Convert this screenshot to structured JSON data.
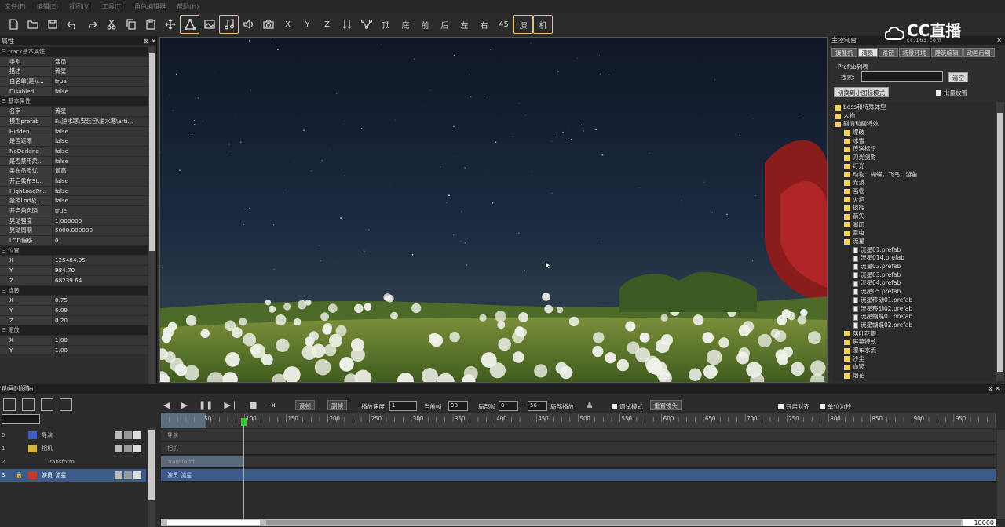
{
  "menubar": [
    "文件(F)",
    "编辑(E)",
    "视图(V)",
    "工具(T)",
    "角色编辑器",
    "帮助(H)"
  ],
  "toolbar": {
    "text_buttons": [
      "X",
      "Y",
      "Z",
      "顶",
      "底",
      "前",
      "后",
      "左",
      "右",
      "45"
    ],
    "highlight_buttons": [
      "演",
      "机"
    ]
  },
  "props_panel": {
    "title": "属性",
    "rows": [
      {
        "section": "track基本属性"
      },
      {
        "k": "类别",
        "v": "演员"
      },
      {
        "k": "描述",
        "v": "流星"
      },
      {
        "k": "白名单(是)/...",
        "v": "true"
      },
      {
        "k": "Disabled",
        "v": "false"
      },
      {
        "section": "基本属性"
      },
      {
        "k": "名字",
        "v": "流星"
      },
      {
        "k": "模型prefab",
        "v": "F:\\逆水寒\\安装包\\逆水寒\\arti..."
      },
      {
        "k": "Hidden",
        "v": "false"
      },
      {
        "k": "是否遮雨",
        "v": "false"
      },
      {
        "k": "NoDarking",
        "v": "false"
      },
      {
        "k": "是否禁用柔...",
        "v": "false"
      },
      {
        "k": "柔布品质优",
        "v": "最高"
      },
      {
        "k": "开启柔布St...",
        "v": "false"
      },
      {
        "k": "HighLoadPr...",
        "v": "false"
      },
      {
        "k": "禁掉Lod及...",
        "v": "false"
      },
      {
        "k": "开启角色阴",
        "v": "true"
      },
      {
        "k": "晃动强度",
        "v": "1.000000"
      },
      {
        "k": "晃动周期",
        "v": "5000.000000"
      },
      {
        "k": "LOD偏移",
        "v": "0"
      },
      {
        "section": "位置"
      },
      {
        "k": "X",
        "v": "125484.95"
      },
      {
        "k": "Y",
        "v": "984.70"
      },
      {
        "k": "Z",
        "v": "68239.64"
      },
      {
        "section": "旋转"
      },
      {
        "k": "X",
        "v": "0.75"
      },
      {
        "k": "Y",
        "v": "6.09"
      },
      {
        "k": "Z",
        "v": "0.20"
      },
      {
        "section": "缩放"
      },
      {
        "k": "X",
        "v": "1.00"
      },
      {
        "k": "Y",
        "v": "1.00"
      }
    ]
  },
  "control_panel": {
    "title": "主控制台",
    "logo": "CC直播",
    "logo_sub": "cc.163.com",
    "tabs": [
      "摄像机",
      "演员",
      "路径",
      "场景环境",
      "建筑编辑",
      "动画后期"
    ],
    "active_tab": "演员",
    "prefab_label": "Prefab列表",
    "search_label": "搜索:",
    "search_value": "",
    "clear_button": "清空",
    "switch_button": "切换到小图标模式",
    "batch_label": "批量放置",
    "tree": [
      {
        "t": "boss和特殊体型",
        "lvl": 0,
        "type": "folder"
      },
      {
        "t": "人物",
        "lvl": 0,
        "type": "folder"
      },
      {
        "t": "剧情动画特效",
        "lvl": 0,
        "type": "folder"
      },
      {
        "t": "爆破",
        "lvl": 1,
        "type": "folder"
      },
      {
        "t": "冰雪",
        "lvl": 1,
        "type": "folder"
      },
      {
        "t": "传送标识",
        "lvl": 1,
        "type": "folder"
      },
      {
        "t": "刀光剑影",
        "lvl": 1,
        "type": "folder"
      },
      {
        "t": "灯光",
        "lvl": 1,
        "type": "folder"
      },
      {
        "t": "动物：蝴蝶，飞鸟，游鱼",
        "lvl": 1,
        "type": "folder"
      },
      {
        "t": "光波",
        "lvl": 1,
        "type": "folder"
      },
      {
        "t": "画卷",
        "lvl": 1,
        "type": "folder"
      },
      {
        "t": "火焰",
        "lvl": 1,
        "type": "folder"
      },
      {
        "t": "技能",
        "lvl": 1,
        "type": "folder"
      },
      {
        "t": "箭矢",
        "lvl": 1,
        "type": "folder"
      },
      {
        "t": "脚印",
        "lvl": 1,
        "type": "folder"
      },
      {
        "t": "雷电",
        "lvl": 1,
        "type": "folder"
      },
      {
        "t": "流星",
        "lvl": 1,
        "type": "folder"
      },
      {
        "t": "流星01.prefab",
        "lvl": 2,
        "type": "file"
      },
      {
        "t": "流星014.prefab",
        "lvl": 2,
        "type": "file"
      },
      {
        "t": "流星02.prefab",
        "lvl": 2,
        "type": "file"
      },
      {
        "t": "流星03.prefab",
        "lvl": 2,
        "type": "file"
      },
      {
        "t": "流星04.prefab",
        "lvl": 2,
        "type": "file"
      },
      {
        "t": "流星05.prefab",
        "lvl": 2,
        "type": "file"
      },
      {
        "t": "流星移动01.prefab",
        "lvl": 2,
        "type": "file"
      },
      {
        "t": "流星移动02.prefab",
        "lvl": 2,
        "type": "file"
      },
      {
        "t": "流星蝴蝶01.prefab",
        "lvl": 2,
        "type": "file"
      },
      {
        "t": "流星蝴蝶02.prefab",
        "lvl": 2,
        "type": "file"
      },
      {
        "t": "落叶花瓣",
        "lvl": 1,
        "type": "folder"
      },
      {
        "t": "屏幕特效",
        "lvl": 1,
        "type": "folder"
      },
      {
        "t": "瀑布水流",
        "lvl": 1,
        "type": "folder"
      },
      {
        "t": "沙尘",
        "lvl": 1,
        "type": "folder"
      },
      {
        "t": "血迹",
        "lvl": 1,
        "type": "folder"
      },
      {
        "t": "烟花",
        "lvl": 1,
        "type": "folder"
      }
    ]
  },
  "timeline": {
    "title": "动画时间轴",
    "set_frame": "设帧",
    "delete_frame": "删帧",
    "speed_label": "播放速度",
    "speed_value": "1",
    "current_frame_label": "当前帧",
    "current_frame_value": "98",
    "local_frame_label": "局部帧",
    "local_from": "0",
    "local_to": "56",
    "local_play": "局部播放",
    "debug_mode": "调试模式",
    "reset_camera": "重置镜头",
    "snap_label": "开启对齐",
    "unit_label": "单位为秒",
    "ruler": [
      "50",
      "100",
      "150",
      "200",
      "250",
      "300",
      "350",
      "400",
      "450",
      "500",
      "550",
      "600",
      "650",
      "700",
      "750",
      "800",
      "850",
      "900",
      "950"
    ],
    "tracks": [
      {
        "idx": "0",
        "name": "导演",
        "color": "#3f5fbf"
      },
      {
        "idx": "1",
        "name": "相机",
        "color": "#d4b43a"
      },
      {
        "idx": "2",
        "name": "Transform",
        "color": ""
      },
      {
        "idx": "3",
        "name": "演员_流星",
        "color": "#c0392b"
      }
    ],
    "lanes": [
      "导演",
      "相机",
      "Transform",
      "演员_流星"
    ],
    "end_value": "10000"
  }
}
